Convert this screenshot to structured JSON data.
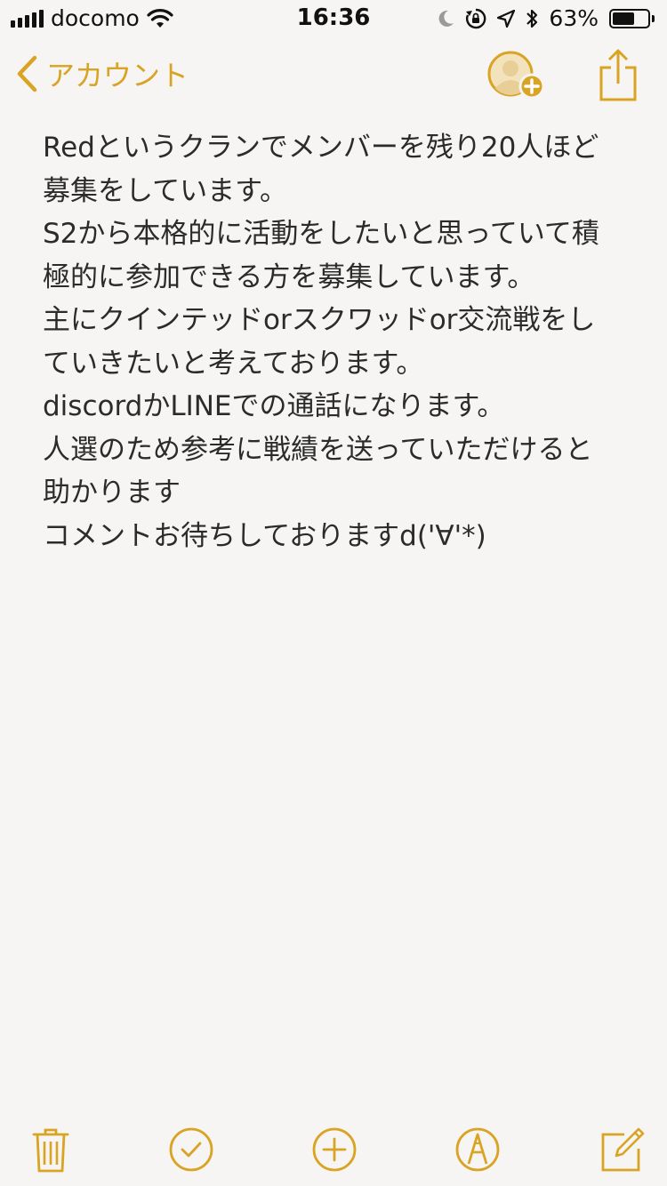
{
  "status_bar": {
    "carrier": "docomo",
    "time": "16:36",
    "battery_percent_label": "63%",
    "battery_level": 0.63,
    "icons": [
      "signal-bars-icon",
      "wifi-icon",
      "moon-icon",
      "rotation-lock-icon",
      "location-arrow-icon",
      "bluetooth-icon",
      "battery-icon"
    ]
  },
  "nav": {
    "back_label": "アカウント",
    "icons": [
      "chevron-left-icon",
      "add-person-icon",
      "share-icon"
    ]
  },
  "note": {
    "lines": [
      "Redというクランでメンバーを残り20人ほど",
      "募集をしています。",
      "S2から本格的に活動をしたいと思っていて積",
      "極的に参加できる方を募集しています。",
      "主にクインテッドorスクワッドor交流戦をし",
      "ていきたいと考えております。",
      "discordかLINEでの通話になります。",
      "人選のため参考に戦績を送っていただけると",
      "助かります",
      "コメントお待ちしておりますd('∀'*)"
    ]
  },
  "toolbar": {
    "icons": [
      "trash-icon",
      "checklist-icon",
      "add-icon",
      "sketch-icon",
      "compose-icon"
    ]
  },
  "colors": {
    "accent": "#d9a323",
    "background": "#f6f5f3",
    "text": "#2b2b2b"
  }
}
